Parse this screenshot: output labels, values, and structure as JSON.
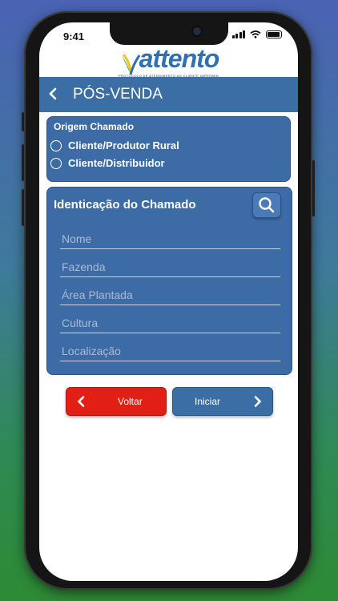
{
  "status": {
    "time": "9:41"
  },
  "logo": {
    "name": "attento",
    "tagline": "PROTOCOLO DE ATENDIMENTO AO CLIENTE IMPERMIN"
  },
  "header": {
    "title": "PÓS-VENDA"
  },
  "origem": {
    "label": "Origem Chamado",
    "options": [
      "Cliente/Produtor Rural",
      "Cliente/Distribuidor"
    ]
  },
  "identificacao": {
    "title": "Identicação do Chamado",
    "fields": [
      {
        "placeholder": "Nome",
        "value": ""
      },
      {
        "placeholder": "Fazenda",
        "value": ""
      },
      {
        "placeholder": "Área Plantada",
        "value": ""
      },
      {
        "placeholder": "Cultura",
        "value": ""
      },
      {
        "placeholder": "Localização",
        "value": ""
      }
    ]
  },
  "buttons": {
    "voltar": "Voltar",
    "iniciar": "Iniciar"
  },
  "colors": {
    "primary": "#3c6ea6",
    "danger": "#e21f14",
    "logo": "#2f6fb3"
  },
  "icons": {
    "back": "chevron-left-icon",
    "search": "search-icon",
    "next": "chevron-right-icon"
  }
}
